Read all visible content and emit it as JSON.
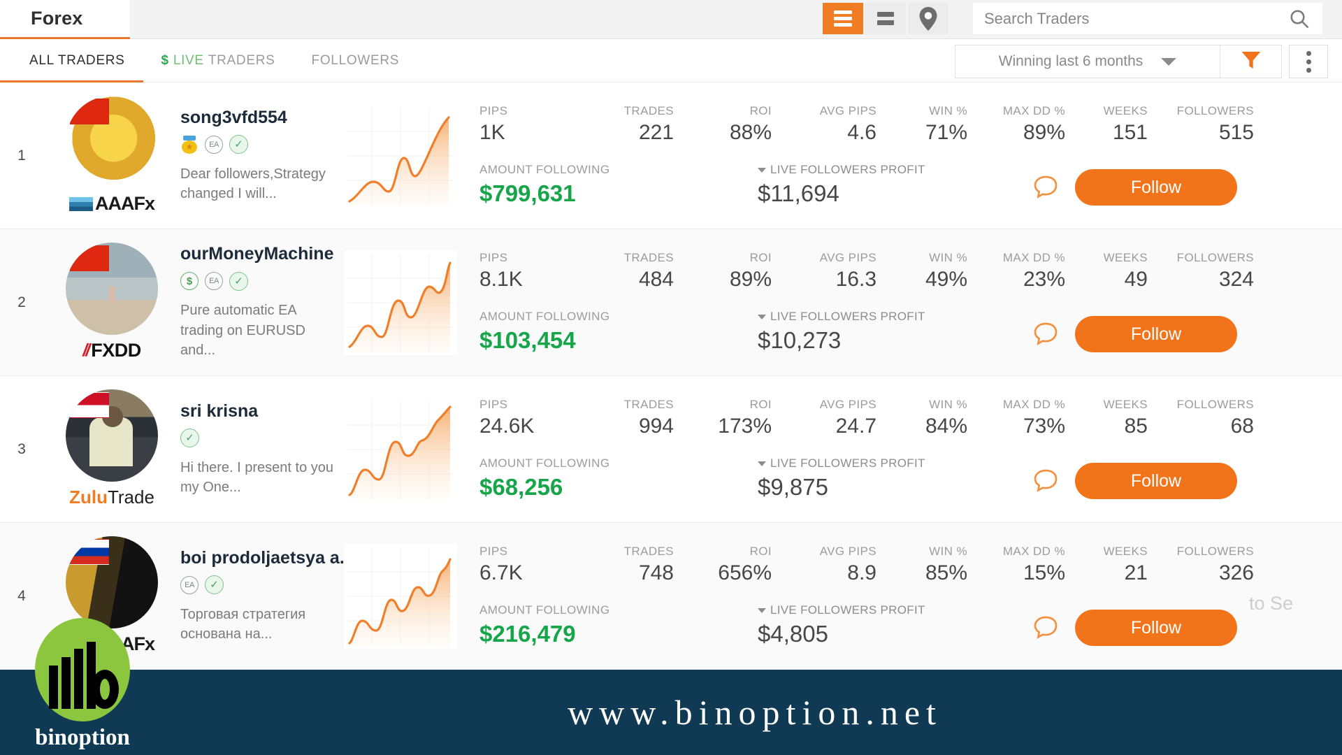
{
  "header": {
    "brand_title": "Forex",
    "view_toggles": [
      {
        "name": "list-view",
        "icon": "list-lines-icon",
        "active": true
      },
      {
        "name": "compact-view",
        "icon": "compact-lines-icon",
        "active": false
      },
      {
        "name": "map-view",
        "icon": "location-pin-icon",
        "active": false
      }
    ],
    "search": {
      "placeholder": "Search Traders",
      "value": "",
      "icon": "search-icon"
    }
  },
  "tabs": [
    {
      "label": "ALL TRADERS",
      "active": true
    },
    {
      "label": "TRADERS",
      "prefix_dollar": "$",
      "prefix_live": "LIVE",
      "active": false
    },
    {
      "label": "FOLLOWERS",
      "active": false
    }
  ],
  "filterbar": {
    "sort_value": "Winning last 6 months",
    "funnel_icon": "filter-funnel-icon",
    "kebab_icon": "more-options-icon"
  },
  "stat_labels": {
    "pips": "PIPS",
    "trades": "TRADES",
    "roi": "ROI",
    "avg_pips": "AVG PIPS",
    "win": "WIN %",
    "max_dd": "MAX DD %",
    "weeks": "WEEKS",
    "followers": "FOLLOWERS",
    "amount_following": "AMOUNT FOLLOWING",
    "live_followers_profit": "LIVE FOLLOWERS PROFIT"
  },
  "follow_label": "Follow",
  "traders": [
    {
      "rank": "1",
      "name": "song3vfd554",
      "flag": "cn",
      "broker": "AAAFx",
      "badges": [
        "medal",
        "ea",
        "verified"
      ],
      "description": "Dear followers,Strategy changed I will...",
      "pips": "1K",
      "trades": "221",
      "roi": "88%",
      "avg_pips": "4.6",
      "win": "71%",
      "max_dd": "89%",
      "weeks": "151",
      "followers": "515",
      "amount_following": "$799,631",
      "live_followers_profit": "$11,694"
    },
    {
      "rank": "2",
      "name": "ourMoneyMachine",
      "flag": "cn",
      "broker": "FXDD",
      "badges": [
        "dollar",
        "ea",
        "verified"
      ],
      "description": "Pure automatic EA trading on EURUSD and...",
      "pips": "8.1K",
      "trades": "484",
      "roi": "89%",
      "avg_pips": "16.3",
      "win": "49%",
      "max_dd": "23%",
      "weeks": "49",
      "followers": "324",
      "amount_following": "$103,454",
      "live_followers_profit": "$10,273"
    },
    {
      "rank": "3",
      "name": "sri krisna",
      "flag": "id",
      "broker": "ZuluTrade",
      "badges": [
        "verified"
      ],
      "description": "Hi there. I present to you my One...",
      "pips": "24.6K",
      "trades": "994",
      "roi": "173%",
      "avg_pips": "24.7",
      "win": "84%",
      "max_dd": "73%",
      "weeks": "85",
      "followers": "68",
      "amount_following": "$68,256",
      "live_followers_profit": "$9,875"
    },
    {
      "rank": "4",
      "name": "boi prodoljaetsya a...",
      "flag": "ru",
      "broker": "AAAFx",
      "badges": [
        "ea",
        "verified"
      ],
      "description": "Торговая стратегия основана на...",
      "pips": "6.7K",
      "trades": "748",
      "roi": "656%",
      "avg_pips": "8.9",
      "win": "85%",
      "max_dd": "15%",
      "weeks": "21",
      "followers": "326",
      "amount_following": "$216,479",
      "live_followers_profit": "$4,805"
    }
  ],
  "ghost_overlay_text": "to Se",
  "footer": {
    "url": "www.binoption.net",
    "logo_text": "binoption"
  },
  "colors": {
    "accent_orange": "#f07d23",
    "tab_underline": "#e8782b",
    "green_amount": "#17a54a",
    "footer_navy": "#103a54",
    "logo_green": "#8cc63f"
  }
}
